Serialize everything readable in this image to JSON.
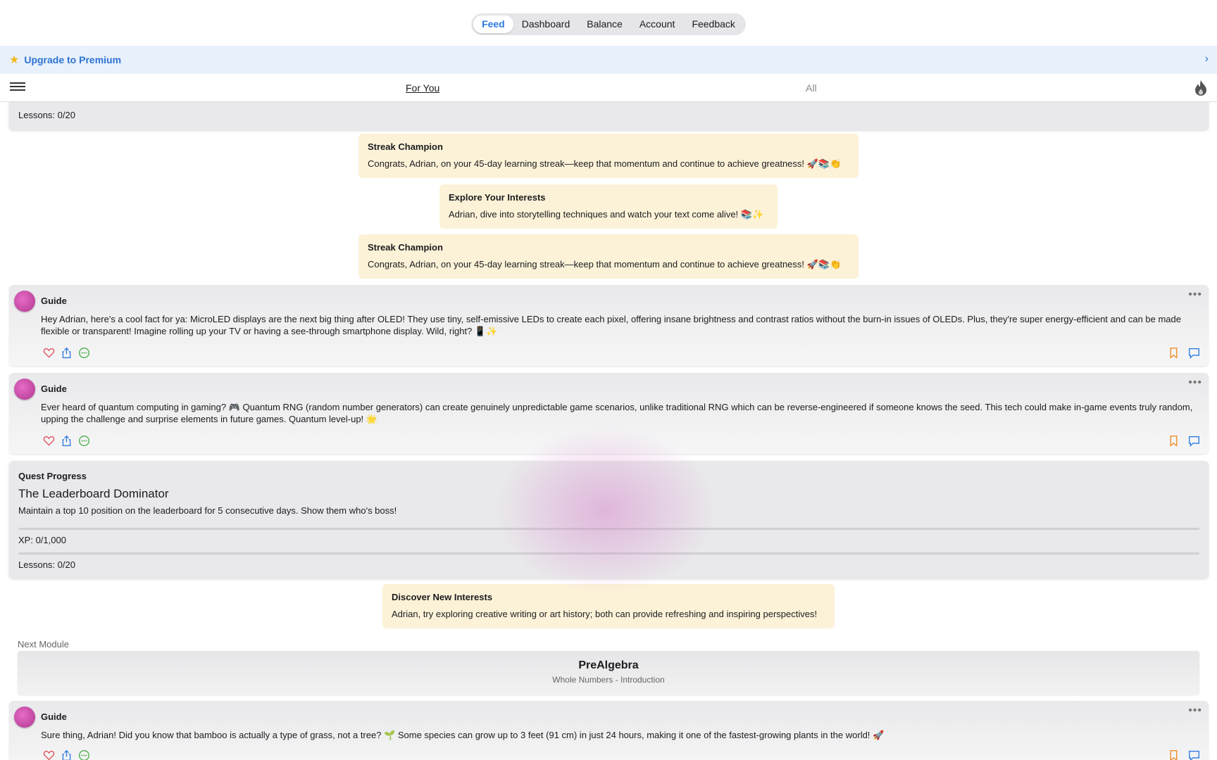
{
  "topnav": {
    "tabs": [
      "Feed",
      "Dashboard",
      "Balance",
      "Account",
      "Feedback"
    ],
    "active": "Feed"
  },
  "premium": {
    "label": "Upgrade to Premium",
    "icon": "star-icon"
  },
  "subnav": {
    "for_you": "For You",
    "all": "All"
  },
  "lessons_top": "Lessons: 0/20",
  "notices": [
    {
      "title": "Streak Champion",
      "body": "Congrats, Adrian, on your 45-day learning streak—keep that momentum and continue to achieve greatness! 🚀📚👏"
    },
    {
      "title": "Explore Your Interests",
      "body": "Adrian, dive into storytelling techniques and watch your text come alive! 📚✨"
    },
    {
      "title": "Streak Champion",
      "body": "Congrats, Adrian, on your 45-day learning streak—keep that momentum and continue to achieve greatness! 🚀📚👏"
    }
  ],
  "posts": [
    {
      "author": "Guide",
      "body": "Hey Adrian, here's a cool fact for ya: MicroLED displays are the next big thing after OLED! They use tiny, self-emissive LEDs to create each pixel, offering insane brightness and contrast ratios without the burn-in issues of OLEDs. Plus, they're super energy-efficient and can be made flexible or transparent! Imagine rolling up your TV or having a see-through smartphone display. Wild, right? 📱✨"
    },
    {
      "author": "Guide",
      "body": "Ever heard of quantum computing in gaming? 🎮 Quantum RNG (random number generators) can create genuinely unpredictable game scenarios, unlike traditional RNG which can be reverse-engineered if someone knows the seed. This tech could make in-game events truly random, upping the challenge and surprise elements in future games. Quantum level-up! 🌟"
    },
    {
      "author": "Guide",
      "body": "Sure thing, Adrian! Did you know that bamboo is actually a type of grass, not a tree? 🌱 Some species can grow up to 3 feet (91 cm) in just 24 hours, making it one of the fastest-growing plants in the world! 🚀"
    }
  ],
  "quest": {
    "header": "Quest Progress",
    "title": "The Leaderboard Dominator",
    "description": "Maintain a top 10 position on the leaderboard for 5 consecutive days. Show them who's boss!",
    "xp": "XP: 0/1,000",
    "lessons": "Lessons: 0/20"
  },
  "discover": {
    "title": "Discover New Interests",
    "body": "Adrian, try exploring creative writing or art history; both can provide refreshing and inspiring perspectives!"
  },
  "next_module": {
    "label": "Next Module",
    "title": "PreAlgebra",
    "subtitle": "Whole Numbers - Introduction"
  },
  "colors": {
    "accent": "#2d7be0",
    "like": "#e0505a",
    "share": "#2d7be0",
    "comment": "#4cae4c",
    "bookmark": "#f08a24",
    "reply": "#2d7be0"
  }
}
